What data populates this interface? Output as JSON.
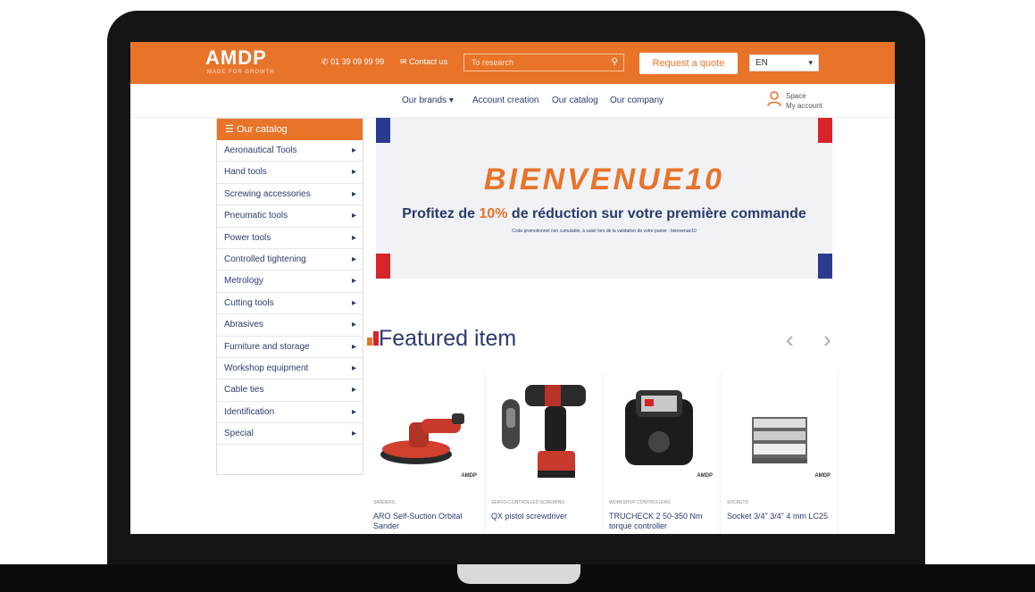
{
  "header": {
    "logo": "AMDP",
    "logo_tagline": "MADE FOR GROWTH",
    "phone": "01 39 09 99 99",
    "contact": "Contact us",
    "search_placeholder": "To research",
    "quote_button": "Request a quote",
    "language": "EN"
  },
  "nav": {
    "items": [
      "Our brands",
      "Account creation",
      "Our catalog",
      "Our company"
    ],
    "user_line1": "Space",
    "user_line2": "My account"
  },
  "sidebar": {
    "title": "Our catalog",
    "items": [
      "Aeronautical Tools",
      "Hand tools",
      "Screwing accessories",
      "Pneumatic tools",
      "Power tools",
      "Controlled tightening",
      "Metrology",
      "Cutting tools",
      "Abrasives",
      "Furniture and storage",
      "Workshop equipment",
      "Cable ties",
      "Identification",
      "Special"
    ]
  },
  "banner": {
    "title": "BIENVENUE10",
    "subtitle_before": "Profitez de ",
    "subtitle_pct": "10%",
    "subtitle_after": " de réduction sur votre première commande",
    "small": "Code promotionnel non cumulable, à saisir lors de la validation de votre panier : bienvenue10"
  },
  "featured": {
    "title": "Featured item",
    "products": [
      {
        "category": "SANDERS",
        "name": "ARO Self-Suction Orbital Sander",
        "brand": "AMDP"
      },
      {
        "category": "SERVO-CONTROLLED SCREWING",
        "name": "QX pistol screwdriver",
        "brand": ""
      },
      {
        "category": "WORKSHOP CONTROLLERS",
        "name": "TRUCHECK 2 50-350 Nm torque controller",
        "brand": "AMDP"
      },
      {
        "category": "SOCKETS",
        "name": "Socket 3/4\" 3/4\" 4 mm LC25",
        "brand": "AMDP"
      }
    ]
  },
  "colors": {
    "accent": "#e8742a",
    "navy": "#2b3a6b",
    "flag_blue": "#2b3a8f",
    "flag_red": "#d6242a"
  }
}
